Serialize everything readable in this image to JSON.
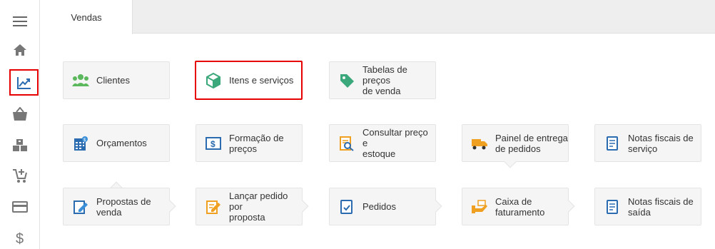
{
  "tab": {
    "label": "Vendas"
  },
  "sidebar": {
    "items": [
      {
        "icon": "hamburger-menu-icon"
      },
      {
        "icon": "home-icon"
      },
      {
        "icon": "trending-up-chart-icon",
        "active": true
      },
      {
        "icon": "shopping-basket-icon"
      },
      {
        "icon": "boxes-icon"
      },
      {
        "icon": "cart-add-icon"
      },
      {
        "icon": "credit-card-icon"
      },
      {
        "icon": "dollar-icon"
      }
    ],
    "active_border_color": "#e60000"
  },
  "tiles": {
    "clientes": "Clientes",
    "itens_servicos": "Itens e serviços",
    "tabelas_precos": "Tabelas de preços\nde venda",
    "orcamentos": "Orçamentos",
    "formacao_precos": "Formação de\npreços",
    "consultar_preco": "Consultar preço e\nestoque",
    "painel_entrega": "Painel de entrega\nde pedidos",
    "nf_servico": "Notas fiscais de\nserviço",
    "propostas_venda": "Propostas de venda",
    "lancar_pedido": "Lançar pedido por\nproposta",
    "pedidos": "Pedidos",
    "caixa_faturamento": "Caixa de\nfaturamento",
    "nf_saida": "Notas fiscais de\nsaída"
  },
  "colors": {
    "highlight": "#e60000",
    "icon_green": "#5cb85c",
    "icon_blue": "#2b6cb0",
    "icon_orange": "#f0a020",
    "sidebar_icon": "#777777"
  }
}
